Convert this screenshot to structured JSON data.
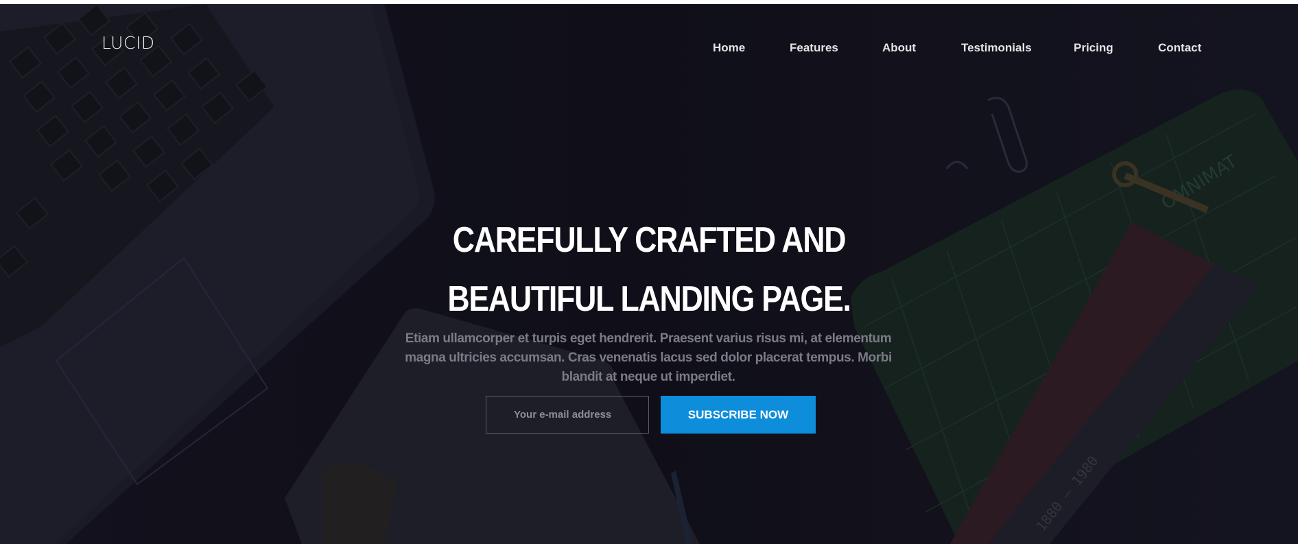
{
  "brand": {
    "logo_text": "LUCID"
  },
  "nav": {
    "items": [
      {
        "label": "Home"
      },
      {
        "label": "Features"
      },
      {
        "label": "About"
      },
      {
        "label": "Testimonials"
      },
      {
        "label": "Pricing"
      },
      {
        "label": "Contact"
      }
    ]
  },
  "hero": {
    "headline_line1": "CAREFULLY CRAFTED AND",
    "headline_line2": "BEAUTIFUL LANDING PAGE.",
    "subtext": "Etiam ullamcorper et turpis eget hendrerit. Praesent varius risus mi, at elementum magna ultricies accumsan. Cras venenatis lacus sed dolor placerat tempus. Morbi blandit at neque ut imperdiet.",
    "email_placeholder": "Your e-mail address",
    "subscribe_label": "SUBSCRIBE NOW"
  },
  "background": {
    "ruler_marks": "1880 — 1980",
    "mat_label": "OMNIMAT"
  },
  "colors": {
    "hero_bg": "#12111c",
    "accent": "#0e8ddb",
    "headline": "#ffffff",
    "subtext": "#7b7b86",
    "input_border": "#5b5b66"
  }
}
